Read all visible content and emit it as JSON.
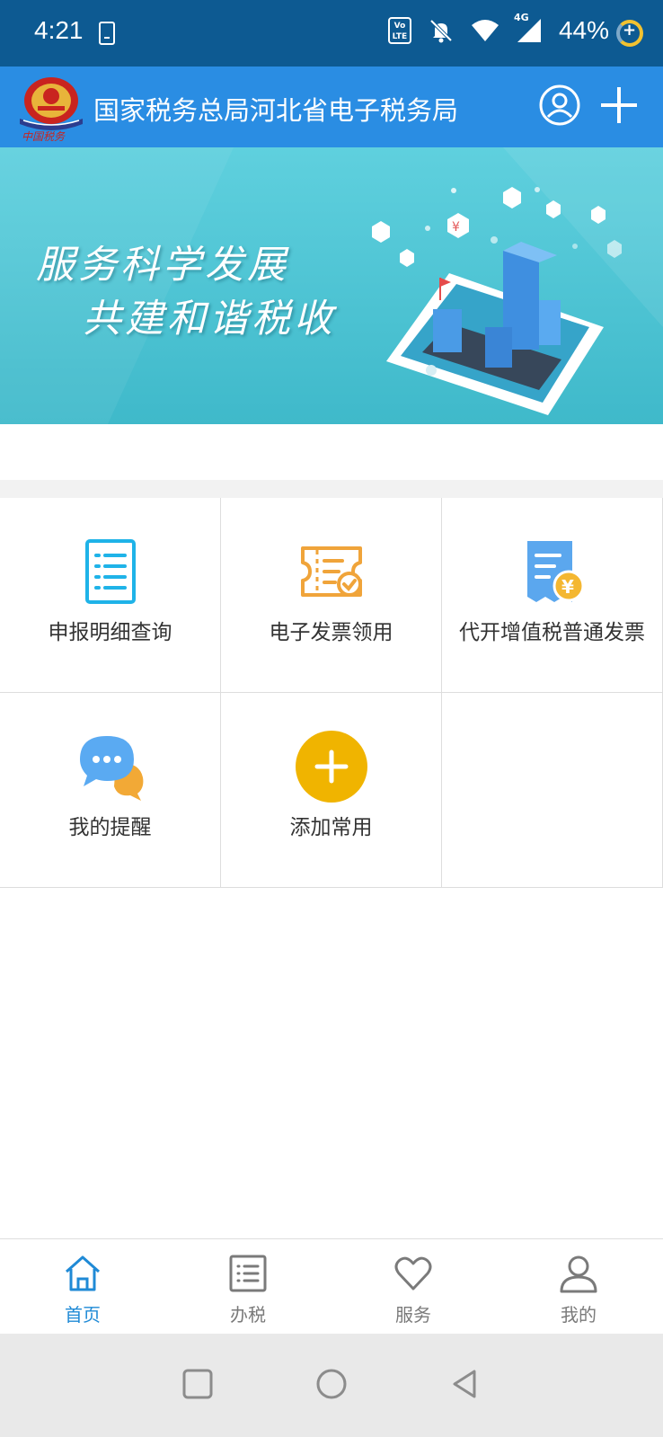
{
  "status_bar": {
    "time": "4:21",
    "volte_text": "Vo LTE",
    "network": "4G",
    "battery": "44%"
  },
  "header": {
    "title": "国家税务总局河北省电子税务局",
    "logo_icon": "tax-emblem-icon",
    "logo_caption": "中国税务",
    "user_icon": "user-circle-icon",
    "add_icon": "plus-icon",
    "bg_color": "#2a8de3"
  },
  "banner": {
    "line1": "服务科学发展",
    "line2": "共建和谐税收",
    "bg_color": "#4cc4d3"
  },
  "grid": {
    "items": [
      {
        "label": "申报明细查询",
        "icon": "document-list-icon"
      },
      {
        "label": "电子发票领用",
        "icon": "ticket-check-icon"
      },
      {
        "label": "代开增值税普通发票",
        "icon": "invoice-yuan-icon"
      },
      {
        "label": "我的提醒",
        "icon": "chat-bubble-icon"
      },
      {
        "label": "添加常用",
        "icon": "add-circle-icon"
      }
    ]
  },
  "bottom_nav": {
    "items": [
      {
        "label": "首页",
        "icon": "home-icon",
        "active": true
      },
      {
        "label": "办税",
        "icon": "list-icon",
        "active": false
      },
      {
        "label": "服务",
        "icon": "heart-icon",
        "active": false
      },
      {
        "label": "我的",
        "icon": "person-icon",
        "active": false
      }
    ],
    "active_color": "#1f8ad6"
  },
  "system_nav": {
    "buttons": [
      "square-recents-icon",
      "circle-home-icon",
      "triangle-back-icon"
    ]
  }
}
